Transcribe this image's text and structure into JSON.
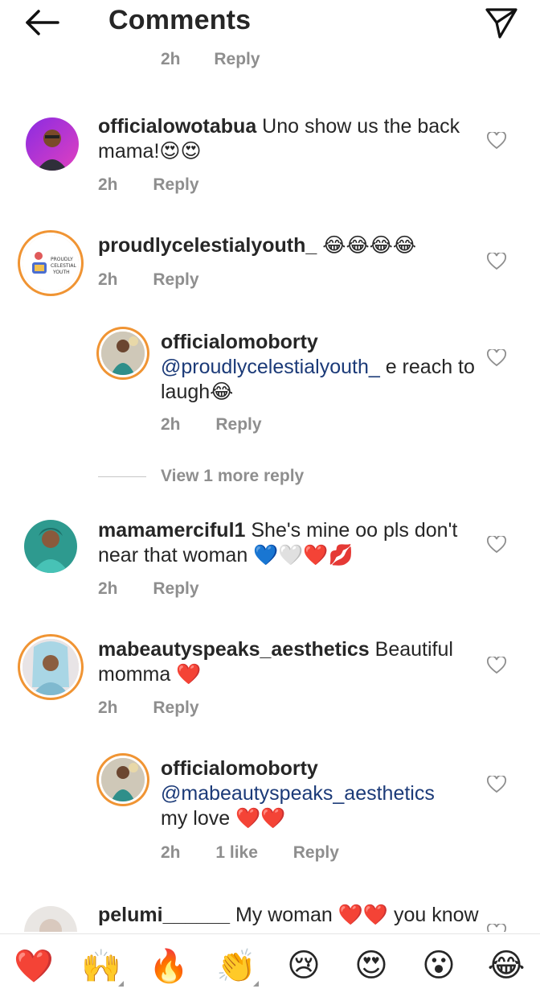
{
  "header": {
    "title": "Comments"
  },
  "partial_top": {
    "time": "2h",
    "reply": "Reply"
  },
  "comments": [
    {
      "user": "officialowotabua",
      "body": " Uno show us the back mama!😍😍",
      "time": "2h",
      "reply": "Reply"
    },
    {
      "user": "proudlycelestialyouth_",
      "body": " 😂😂😂😂",
      "time": "2h",
      "reply": "Reply"
    },
    {
      "user": "officialomoborty",
      "mention": "@proudlycelestialyouth_",
      "body": " e reach to laugh😂",
      "time": "2h",
      "reply": "Reply"
    },
    {
      "user": "mamamerciful1",
      "body": " She's mine oo pls don't near that woman 💙🤍❤️💋",
      "time": "2h",
      "reply": "Reply"
    },
    {
      "user": "mabeautyspeaks_aesthetics",
      "body": " Beautiful momma ❤️",
      "time": "2h",
      "reply": "Reply"
    },
    {
      "user": "officialomoborty",
      "mention": "@mabeautyspeaks_aesthetics",
      "body": " my love ❤️❤️",
      "time": "2h",
      "likes": "1 like",
      "reply": "Reply"
    },
    {
      "user": "pelumi______",
      "body": " My woman ❤️❤️ you know",
      "time": "",
      "reply": ""
    }
  ],
  "view_more": "View 1 more reply",
  "logo_text": [
    "PROUDLY",
    "CELESTIAL",
    "YOUTH"
  ],
  "emoji_bar": [
    {
      "emoji": "❤️",
      "name": "heart"
    },
    {
      "emoji": "🙌",
      "name": "raised-hands",
      "variants": true
    },
    {
      "emoji": "🔥",
      "name": "fire"
    },
    {
      "emoji": "👏",
      "name": "clap",
      "variants": true
    },
    {
      "emoji": "😢",
      "name": "crying"
    },
    {
      "emoji": "😍",
      "name": "heart-eyes"
    },
    {
      "emoji": "😮",
      "name": "surprised"
    },
    {
      "emoji": "😂",
      "name": "laughing"
    }
  ],
  "colors": {
    "text": "#262626",
    "muted": "#8e8e8e",
    "mention": "#1b3a78",
    "story_ring": "#f09433"
  }
}
